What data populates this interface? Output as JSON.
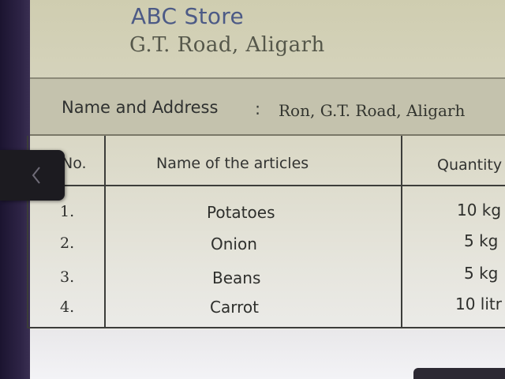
{
  "store": {
    "name": "ABC Store",
    "address": "G.T. Road, Aligarh"
  },
  "customer": {
    "label": "Name and Address",
    "separator": ":",
    "value": "Ron, G.T. Road, Aligarh"
  },
  "table": {
    "headers": {
      "no": "No.",
      "article": "Name of the articles",
      "quantity": "Quantity"
    },
    "rows": [
      {
        "no": "1.",
        "article": "Potatoes",
        "quantity": "10 kg"
      },
      {
        "no": "2.",
        "article": "Onion",
        "quantity": "5 kg"
      },
      {
        "no": "3.",
        "article": "Beans",
        "quantity": "5 kg"
      },
      {
        "no": "4.",
        "article": "Carrot",
        "quantity": "10 litr"
      }
    ]
  },
  "icons": {
    "back": "chevron-left-icon"
  },
  "colors": {
    "store_name": "#4c5a86",
    "back_tab": "#1c1b20"
  }
}
